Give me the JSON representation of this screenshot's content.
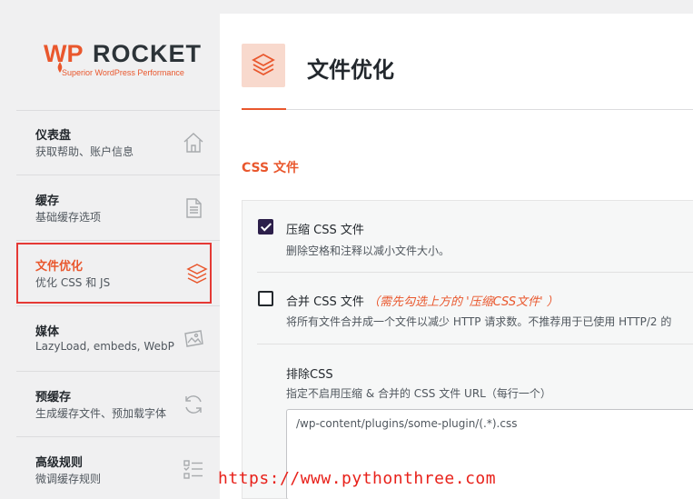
{
  "logo": {
    "brand_wp": "WP",
    "brand_rocket": "ROCKET",
    "tagline": "Superior WordPress Performance"
  },
  "nav": {
    "items": [
      {
        "title": "仪表盘",
        "subtitle": "获取帮助、账户信息",
        "icon": "home-icon"
      },
      {
        "title": "缓存",
        "subtitle": "基础缓存选项",
        "icon": "document-icon"
      },
      {
        "title": "文件优化",
        "subtitle": "优化 CSS 和 JS",
        "icon": "layers-icon",
        "active": true
      },
      {
        "title": "媒体",
        "subtitle": "LazyLoad, embeds, WebP",
        "icon": "image-icon"
      },
      {
        "title": "预缓存",
        "subtitle": "生成缓存文件、预加载字体",
        "icon": "refresh-icon"
      },
      {
        "title": "高级规则",
        "subtitle": "微调缓存规则",
        "icon": "list-icon"
      }
    ]
  },
  "header": {
    "title": "文件优化",
    "icon": "layers-icon"
  },
  "section": {
    "title": "CSS 文件"
  },
  "options": {
    "minify": {
      "label": "压缩 CSS 文件",
      "description": "删除空格和注释以减小文件大小。",
      "checked": true
    },
    "combine": {
      "label": "合并 CSS 文件",
      "note": "（需先勾选上方的 '压缩CSS文件' ）",
      "description": "将所有文件合并成一个文件以减少 HTTP 请求数。不推荐用于已使用 HTTP/2 的",
      "checked": false
    },
    "exclude": {
      "label": "排除CSS",
      "description": "指定不启用压缩 & 合并的 CSS 文件 URL（每行一个）",
      "value": "/wp-content/plugins/some-plugin/(.*).css"
    }
  },
  "watermark": "https://www.pythonthree.com",
  "colors": {
    "accent": "#e9572d",
    "checkbox": "#2c1f4a",
    "highlight_border": "#e53935"
  }
}
